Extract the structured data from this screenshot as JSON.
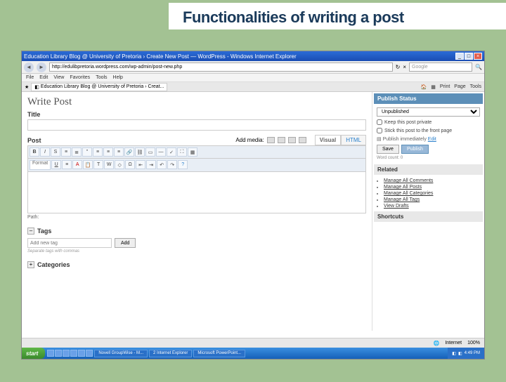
{
  "slide": {
    "title": "Functionalities of writing a post"
  },
  "window": {
    "title": "Education Library Blog @ University of Pretoria › Create New Post — WordPress - Windows Internet Explorer",
    "url": "http://edulibpretoria.wordpress.com/wp-admin/post-new.php",
    "search_placeholder": "Google",
    "menus": [
      "File",
      "Edit",
      "View",
      "Favorites",
      "Tools",
      "Help"
    ],
    "tab": "Education Library Blog @ University of Pretoria › Creat...",
    "toolbar_labels": {
      "home": "Home",
      "print": "Print",
      "page": "Page",
      "tools": "Tools"
    }
  },
  "editor": {
    "page_title": "Write Post",
    "title_label": "Title",
    "post_label": "Post",
    "add_media": "Add media:",
    "tabs": {
      "visual": "Visual",
      "html": "HTML"
    },
    "format": "Format",
    "path": "Path:",
    "tags_label": "Tags",
    "tag_placeholder": "Add new tag",
    "add_btn": "Add",
    "tag_hint": "Separate tags with commas",
    "categories_label": "Categories"
  },
  "publish": {
    "header": "Publish Status",
    "status": "Unpublished",
    "private": "Keep this post private",
    "frontpage": "Stick this post to the front page",
    "immediate": "Publish immediately",
    "edit": "Edit",
    "save": "Save",
    "publish": "Publish",
    "wordcount": "Word count: 0"
  },
  "related": {
    "header": "Related",
    "links": [
      "Manage All Comments",
      "Manage All Posts",
      "Manage All Categories",
      "Manage All Tags",
      "View Drafts"
    ]
  },
  "shortcuts": {
    "header": "Shortcuts"
  },
  "statusbar": {
    "internet": "Internet",
    "zoom": "100%"
  },
  "taskbar": {
    "start": "start",
    "items": [
      "Novell GroupWise - M...",
      "2 Internet Explorer",
      "Microsoft PowerPoint..."
    ],
    "time": "4:49 PM"
  }
}
